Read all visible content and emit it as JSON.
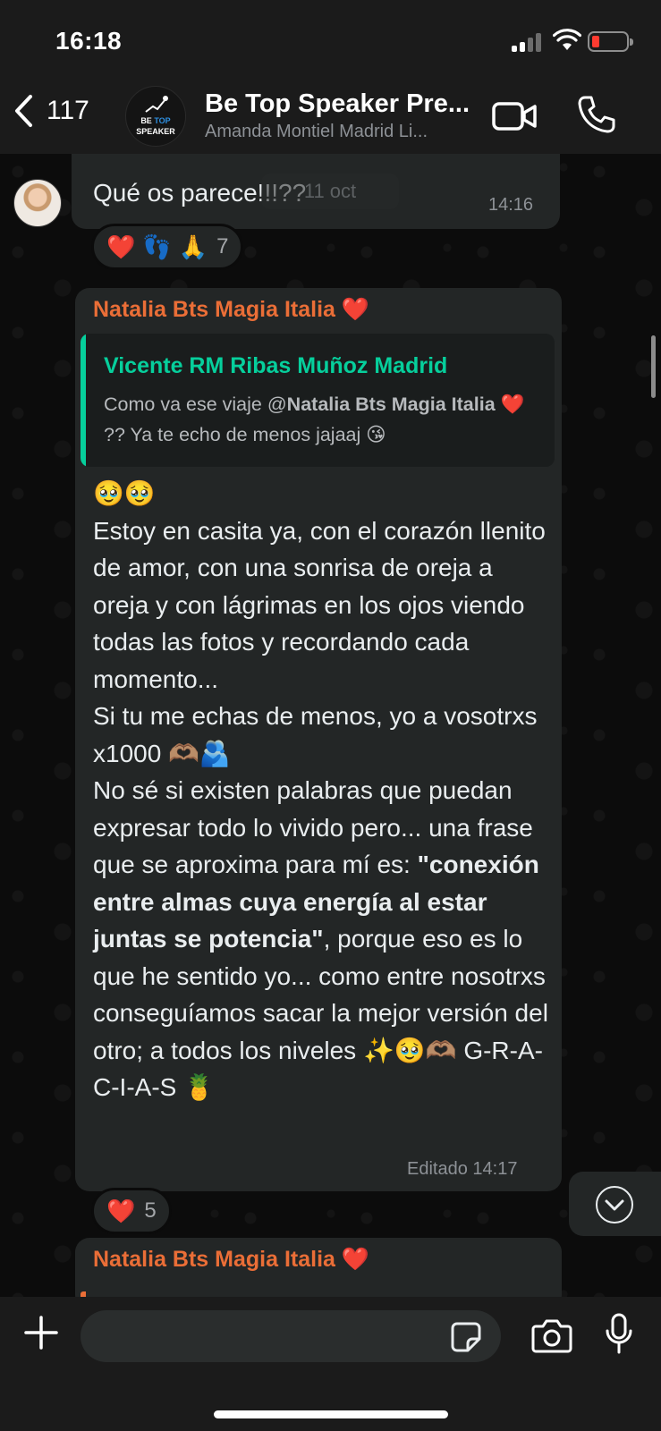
{
  "status_bar": {
    "time": "16:18"
  },
  "header": {
    "back_count": "117",
    "group_name": "Be Top Speaker Pre...",
    "group_members": "Amanda Montiel Madrid Li...",
    "avatar_logo": {
      "line1_a": "BE ",
      "line1_b": "TOP",
      "line2": "SPEAKER"
    }
  },
  "date_chip": "11 oct",
  "messages": [
    {
      "text": "Qué os parece!!!??",
      "time": "14:16",
      "reactions": {
        "emojis": [
          "❤️",
          "👣",
          "🙏"
        ],
        "count": "7"
      }
    },
    {
      "sender": "Natalia Bts Magia Italia ❤️",
      "quote": {
        "author": "Vicente RM Ribas Muñoz Madrid",
        "text_before": "Como va ese viaje @",
        "mention": "Natalia Bts Magia Italia",
        "text_after": " ❤️ ?? Ya te echo de menos jajaaj 😘"
      },
      "body": {
        "p1": "🥹🥹",
        "p2": "Estoy en casita ya, con el corazón llenito de amor, con una sonrisa de oreja a oreja y con lágrimas en los ojos viendo todas las fotos y recordando cada momento...",
        "p3": "Si tu me echas de menos, yo a vosotrxs x1000 🫶🏽🫂",
        "p4_start": "No sé si existen palabras que puedan expresar todo lo vivido pero... una frase que se aproxima para mí es: ",
        "p4_bold": "\"conexión entre almas cuya energía al estar juntas se potencia\"",
        "p4_end": ", porque eso es lo que he sentido yo... como entre nosotrxs conseguíamos sacar la mejor versión del otro; a todos los niveles ✨🥹🫶🏽  G-R-A-C-I-A-S 🍍"
      },
      "edited_time": "Editado 14:17",
      "reactions": {
        "emojis": [
          "❤️"
        ],
        "count": "5"
      }
    },
    {
      "sender": "Natalia Bts Magia Italia ❤️"
    }
  ],
  "input": {
    "placeholder": ""
  },
  "colors": {
    "sender": "#ea6e37",
    "quote_author": "#06cf9c",
    "bubble": "#232626",
    "bars": "#1b1b1b"
  }
}
